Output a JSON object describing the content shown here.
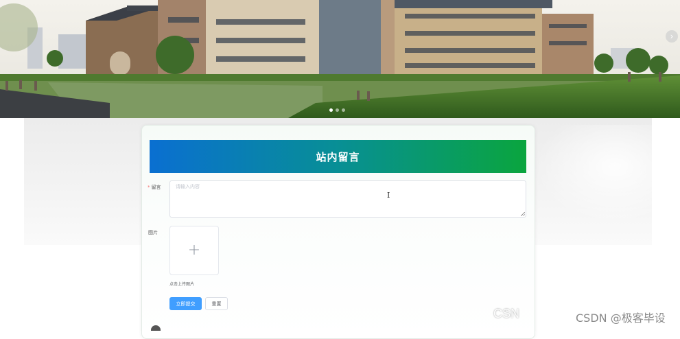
{
  "banner": {
    "next_icon": "chevron-right-icon",
    "next_glyph": "›",
    "slide_count": 3,
    "active_slide": 1
  },
  "form": {
    "title": "站内留言",
    "message_required_mark": "*",
    "message_label": "留言",
    "message_placeholder": "请输入内容",
    "image_label": "图片",
    "upload_icon": "plus-icon",
    "upload_glyph": "+",
    "upload_hint": "点击上传图片",
    "submit_label": "立即提交",
    "reset_label": "重置"
  },
  "watermark": {
    "text_a": "CSN",
    "text_b": "CSDN @极客毕设"
  },
  "colors": {
    "header_gradient_start": "#0a6fd1",
    "header_gradient_end": "#0aa53e",
    "primary_button": "#409eff",
    "required_mark": "#f56c6c"
  }
}
